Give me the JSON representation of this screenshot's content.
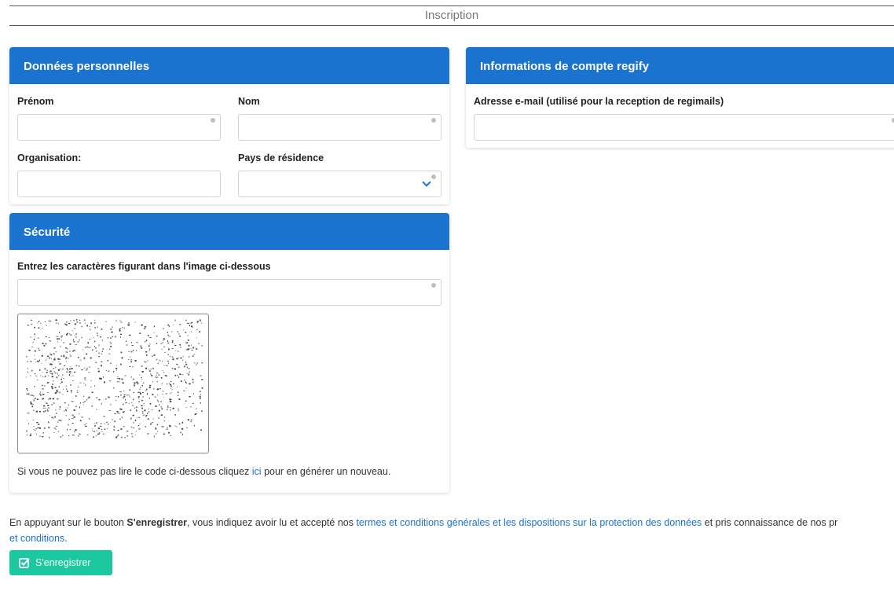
{
  "page": {
    "title": "Inscription"
  },
  "personal": {
    "title": "Données personnelles",
    "first_name_label": "Prénom",
    "first_name_value": "",
    "last_name_label": "Nom",
    "last_name_value": "",
    "organisation_label": "Organisation:",
    "organisation_value": "",
    "country_label": "Pays de résidence",
    "country_value": ""
  },
  "account": {
    "title": "Informations de compte regify",
    "email_label": "Adresse e-mail (utilisé pour la reception de regimails)",
    "email_value": ""
  },
  "security": {
    "title": "Sécurité",
    "captcha_label": "Entrez les caractères figurant dans l'image ci-dessous",
    "captcha_value": "",
    "hint_before": "Si vous ne pouvez pas lire le code ci-dessous cliquez ",
    "hint_link": "ici",
    "hint_after": " pour en générer un nouveau."
  },
  "legal": {
    "text_1": "En appuyant sur le bouton ",
    "button_ref": "S'enregistrer",
    "text_2": ", vous indiquez avoir lu et accepté nos ",
    "terms_link": "termes et conditions générales et les dispositions sur la protection des données",
    "text_3": " et pris connaissance de nos pr",
    "line2_link": "et conditions",
    "line2_end": "."
  },
  "submit": {
    "label": "S'enregistrer"
  },
  "colors": {
    "header_blue": "#1a73cf",
    "submit_green": "#1cc8a0",
    "link_blue": "#1a73cf"
  },
  "icons": {
    "submit": "check-square-icon",
    "country_select": "chevron-down-icon",
    "required": "required-dot-icon"
  }
}
